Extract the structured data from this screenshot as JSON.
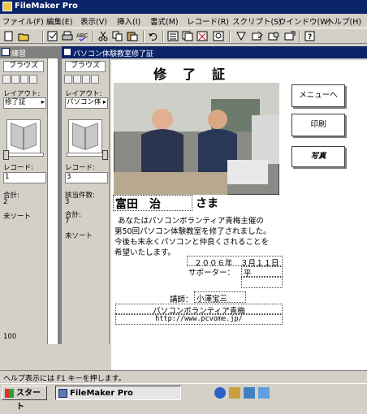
{
  "window": {
    "title": "FileMaker Pro"
  },
  "menu": [
    "ファイル(F)",
    "編集(E)",
    "表示(V)",
    "挿入(I)",
    "書式(M)",
    "レコード(R)",
    "スクリプト(S)",
    "ウインドウ(W)",
    "ヘルプ(H)"
  ],
  "windows": {
    "left": {
      "title": "練習"
    },
    "right": {
      "title": "パソコン体験教室修了証"
    }
  },
  "sidebar_left": {
    "tab": "ブラウズ",
    "layout_label": "レイアウト:",
    "layout_value": "修了証",
    "record_label": "レコード:",
    "record_value": "1",
    "total_label": "合計:",
    "total_value": "2",
    "sort": "未ソート",
    "zoom": "100"
  },
  "sidebar_right": {
    "tab": "ブラウズ",
    "layout_label": "レイアウト:",
    "layout_value": "パソコン体",
    "record_label": "レコード:",
    "record_value": "3",
    "found_label": "該当件数:",
    "found_value": "3",
    "total_label": "合計:",
    "total_value": "7",
    "sort": "未ソート"
  },
  "certificate": {
    "title": "修　了　証",
    "name": "富田　治",
    "honorific": "さま",
    "body": [
      "あなたはパソコンボランティア青梅主催の",
      "第50回パソコン体験教室を修了されました。",
      "今後も末永くパソコンと仲良くされることを",
      "希望いたします。"
    ],
    "date": "２００６年　３月１１日",
    "supporter_label": "サポーター：",
    "supporter_value": "平",
    "lecturer_label": "講師：",
    "lecturer_value": "小澤宝三",
    "organization": "パソコンボランティア青梅",
    "url": "http://www.pcvome.jp/"
  },
  "buttons": {
    "menu": "メニューへ",
    "print": "印刷",
    "photo": "写真"
  },
  "status": "ヘルプ表示には F1 キーを押します。",
  "taskbar": {
    "start": "スタート",
    "task": "FileMaker Pro"
  },
  "colors": {
    "titlebar": "#0a246a",
    "inactive_title": "#808080",
    "chrome": "#d4d0c8"
  }
}
